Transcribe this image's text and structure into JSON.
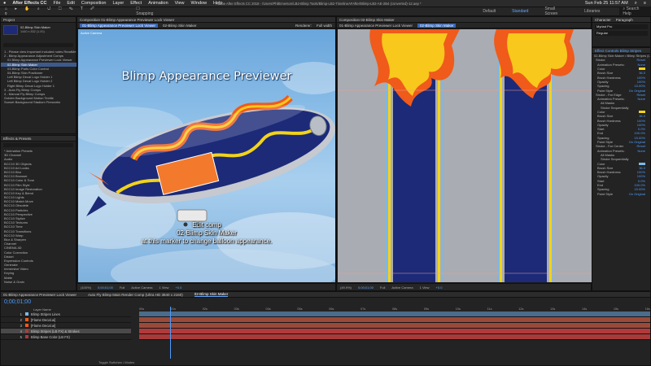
{
  "menubar": {
    "app": "After Effects CC",
    "items": [
      "File",
      "Edit",
      "Composition",
      "Layer",
      "Effect",
      "Animation",
      "View",
      "Window",
      "Help"
    ],
    "window_title": "Adobe After Effects CC 2018 - /Users/PhilEmerson/LB2-Blimp Tools/Blimp-LB2-TimelineAFAfter/Blimp-LB2-AE-2B4 (converted)-12.aep *",
    "clock": "Sun Feb 25 11:57 AM"
  },
  "topbar": {
    "snapping": "Snapping",
    "workspaces": [
      "Default",
      "Standard",
      "Small Screen",
      "Libraries"
    ],
    "search": "Search Help"
  },
  "project": {
    "tab": "Project",
    "selected_name": "02-Blimp Skin Maker",
    "selected_meta": "1440 x 832 (1.00)",
    "items": [
      "1 - Please view Important Included notes ReadMe",
      "2 - Blimp Appearance Adjustment Comps",
      "01 Blimp Appearance Previewer Lock Viewer",
      "02-Blimp Skin Maker",
      "03-Blimp Parts Color Control",
      "04-Blimp Skin Positioner",
      "Left Blimp Decal Logo Holder 1",
      "Left Blimp Decal Logo Holder 2",
      "Right Blimp Decal Logo Holder 1",
      "3 - Auto Fly Blimp Comps",
      "4 - Manual Fly Blimp Comps",
      "Golden Background Motion Textile",
      "Sunset Background Stadium Fireworks"
    ]
  },
  "effects": {
    "tab": "Effects & Presets",
    "items": [
      "* Animation Presets",
      "3D Channel",
      "Audio",
      "BCC10 3D Objects",
      "BCC10 Art Looks",
      "BCC10 Blur",
      "BCC10 Browser",
      "BCC10 Color & Tone",
      "BCC10 Film Style",
      "BCC10 Image Restoration",
      "BCC10 Key & Blend",
      "BCC10 Lights",
      "BCC10 Match Move",
      "BCC10 Obsolete",
      "BCC10 Particles",
      "BCC10 Perspective",
      "BCC10 Stylize",
      "BCC10 Textures",
      "BCC10 Time",
      "BCC10 Transitions",
      "BCC10 Warp",
      "Blur & Sharpen",
      "Channel",
      "CINEMA 4D",
      "Color Correction",
      "Distort",
      "Expression Controls",
      "Generate",
      "Immersive Video",
      "Keying",
      "Matte",
      "Noise & Grain"
    ]
  },
  "left_viewer": {
    "tab": "Composition 01-Blimp Appearance Previewer Lock Viewer",
    "subtab": "01-Blimp Appearance Previewer Lock Viewer",
    "subtab2": "02-Blimp Skin Maker",
    "label": "Active Camera",
    "renderer": "Renderer:",
    "renderer_mode": "Full width",
    "title": "Blimp Appearance Previewer",
    "caption_lines": [
      "Edit comp",
      "02-Blimp Skin Maker",
      "at this marker to change balloon appearance."
    ],
    "footer": {
      "zoom": "(100%)",
      "time": "0;00;01;00",
      "quality": "Full",
      "camera": "Active Camera",
      "views": "1 View",
      "exposure": "+0.0"
    }
  },
  "right_viewer": {
    "tab": "Composition 02-Blimp Skin Maker",
    "subtab": "01-Blimp Appearance Previewer Lock Viewer",
    "subtab2": "02-Blimp Skin Maker",
    "footer": {
      "zoom": "(49.9%)",
      "time": "0;00;01;00",
      "quality": "Full",
      "camera": "Active Camera",
      "views": "1 View",
      "exposure": "+0.0"
    }
  },
  "character": {
    "tab": "Character",
    "tab2": "Paragraph",
    "font": "Myriad Pro",
    "style": "Regular"
  },
  "effect_controls": {
    "tab": "Effect Controls Blimp Stripes",
    "header": "02-Blimp Skin Maker • Blimp Stripes (LB FX)",
    "rows": [
      {
        "label": "Stroke",
        "value": "Reset"
      },
      {
        "label": "Animation Presets:",
        "value": "None"
      },
      {
        "label": "Color",
        "value": ""
      },
      {
        "label": "Brush Size",
        "value": "36.0"
      },
      {
        "label": "Brush Hardness",
        "value": "100%"
      },
      {
        "label": "Opacity",
        "value": "100%"
      },
      {
        "label": "Spacing",
        "value": "15.00%"
      },
      {
        "label": "Paint Style",
        "value": "On Original"
      },
      {
        "label": "Stroke - Far Edge",
        "value": "Reset"
      },
      {
        "label": "Animation Presets:",
        "value": "None"
      },
      {
        "label": "All Masks",
        "value": ""
      },
      {
        "label": "Stroke Sequentially",
        "value": ""
      },
      {
        "label": "Color",
        "value": ""
      },
      {
        "label": "Brush Size",
        "value": "36.0"
      },
      {
        "label": "Brush Hardness",
        "value": "100%"
      },
      {
        "label": "Opacity",
        "value": "100%"
      },
      {
        "label": "Start",
        "value": "0.0%"
      },
      {
        "label": "End",
        "value": "100.0%"
      },
      {
        "label": "Spacing",
        "value": "15.00%"
      },
      {
        "label": "Paint Style",
        "value": "On Original"
      },
      {
        "label": "Stroke - Far Center",
        "value": "Reset"
      },
      {
        "label": "Animation Presets:",
        "value": "None"
      },
      {
        "label": "All Masks",
        "value": ""
      },
      {
        "label": "Stroke Sequentially",
        "value": ""
      },
      {
        "label": "Color",
        "value": ""
      },
      {
        "label": "Brush Size",
        "value": "36.0"
      },
      {
        "label": "Brush Hardness",
        "value": "100%"
      },
      {
        "label": "Opacity",
        "value": "100%"
      },
      {
        "label": "Start",
        "value": "0.0%"
      },
      {
        "label": "End",
        "value": "100.0%"
      },
      {
        "label": "Spacing",
        "value": "15.00%"
      },
      {
        "label": "Paint Style",
        "value": "On Original"
      }
    ]
  },
  "timeline": {
    "tabs": [
      "01-Blimp Appearance Previewer Lock Viewer",
      "Auto Fly Blimp Main Render Comp (Ultra HD 3840 x 2160)",
      "02-Blimp Skin Maker"
    ],
    "timecode": "0;00;01;00",
    "column_header": "Layer Name",
    "layers": [
      {
        "num": "1",
        "name": "Blimp Stripes Lines"
      },
      {
        "num": "2",
        "name": "[Flame Decal.ai]"
      },
      {
        "num": "3",
        "name": "[Flame Decal.ai]"
      },
      {
        "num": "4",
        "name": "Blimp Stripes (LB FX) & Strokes"
      },
      {
        "num": "5",
        "name": "Blimp Base Color (LB FX)"
      }
    ],
    "ruler": [
      "00s",
      "01s",
      "02s",
      "03s",
      "04s",
      "05s",
      "06s",
      "07s",
      "08s",
      "09s",
      "10s",
      "11s",
      "12s",
      "13s",
      "14s",
      "15s",
      "16s"
    ],
    "footer": "Toggle Switches / Modes"
  },
  "colors": {
    "accent_blue": "#2f7fe6",
    "stripe_navy": "#1c2a78",
    "stripe_yellow": "#f2d31a",
    "stripe_light": "#7cb8e8",
    "flame_orange": "#f05a1a",
    "flame_yellow": "#f8c81c",
    "layer_red": "#b23a3a"
  }
}
